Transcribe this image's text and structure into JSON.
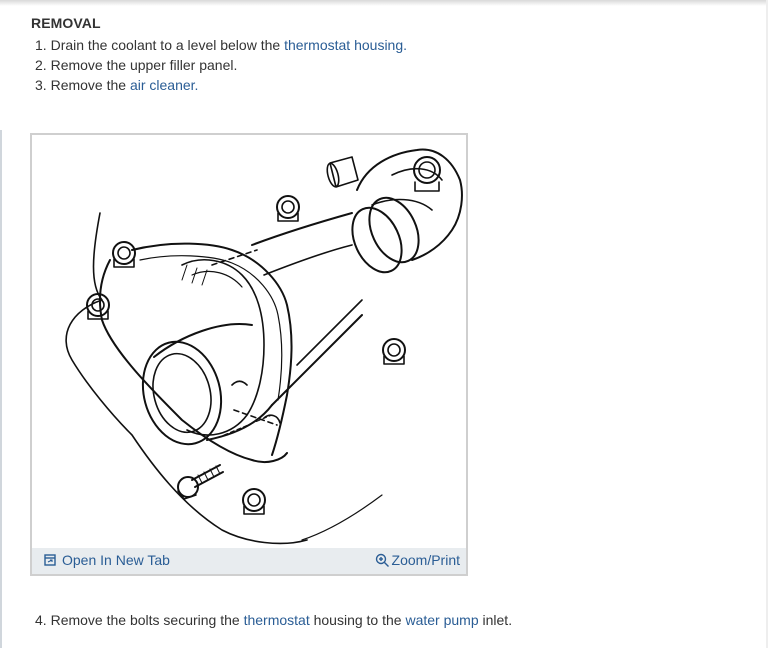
{
  "section": {
    "title": "REMOVAL"
  },
  "steps": [
    {
      "number": "1.",
      "before": "Drain the coolant to a level below the",
      "link": "thermostat housing.",
      "after": ""
    },
    {
      "number": "2.",
      "text": "Remove the upper filler panel."
    },
    {
      "number": "3.",
      "before": "Remove the",
      "link": "air cleaner.",
      "after": ""
    }
  ],
  "figure": {
    "open_tab_label": "Open In New Tab",
    "zoom_label": "Zoom/Print",
    "open_tab_icon": "open-in-new-tab-icon",
    "zoom_icon": "zoom-in-icon"
  },
  "step4": {
    "number": "4.",
    "before": "Remove the bolts securing the",
    "link1": "thermostat",
    "middle": "housing to the",
    "link2": "water pump",
    "after": "inlet."
  },
  "colors": {
    "link": "#2a5d95",
    "text": "#333333",
    "figure_bar": "#e8ecef",
    "figure_border": "#cfcfcf"
  }
}
